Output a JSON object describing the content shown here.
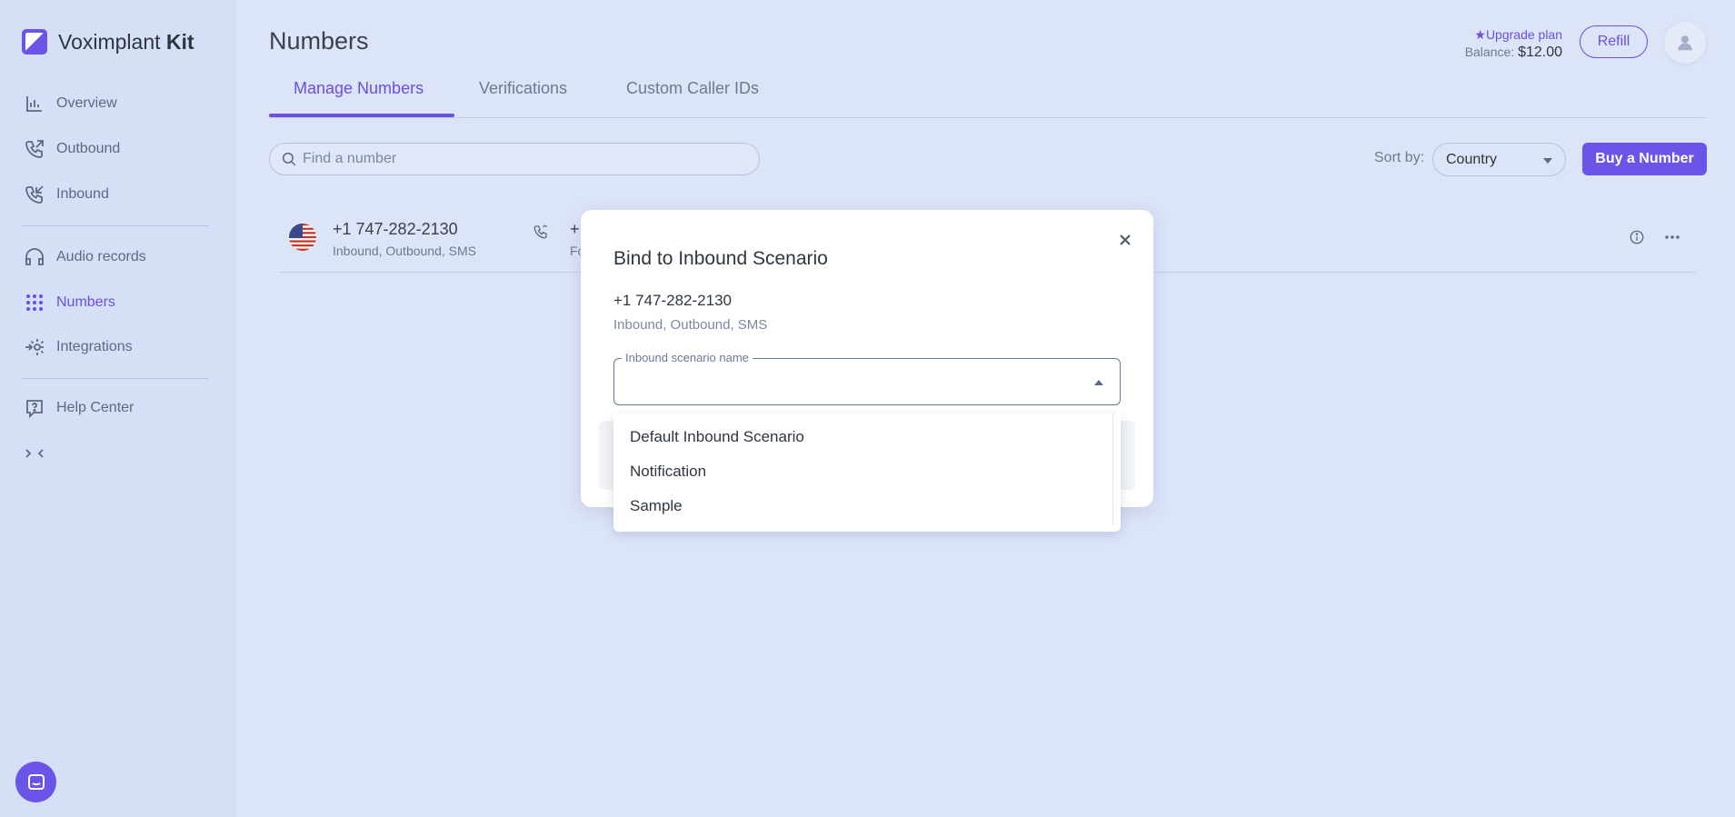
{
  "brand": {
    "name_light": "Voximplant",
    "name_bold": "Kit"
  },
  "sidebar": {
    "items": [
      {
        "label": "Overview",
        "icon": "overview-icon"
      },
      {
        "label": "Outbound",
        "icon": "outbound-call-icon"
      },
      {
        "label": "Inbound",
        "icon": "inbound-call-icon"
      },
      {
        "label": "Audio records",
        "icon": "headphones-icon"
      },
      {
        "label": "Numbers",
        "icon": "dialpad-icon",
        "active": true
      },
      {
        "label": "Integrations",
        "icon": "integrations-gear-icon"
      },
      {
        "label": "Help Center",
        "icon": "help-icon"
      }
    ],
    "collapse_icon": "collapse-arrows-icon"
  },
  "header": {
    "title": "Numbers",
    "upgrade_label": "Upgrade plan",
    "balance_label": "Balance:",
    "balance_value": "$12.00",
    "refill_label": "Refill"
  },
  "tabs": [
    "Manage Numbers",
    "Verifications",
    "Custom Caller IDs"
  ],
  "toolbar": {
    "search_placeholder": "Find a number",
    "sort_label": "Sort by:",
    "sort_value": "Country",
    "buy_label": "Buy a Number"
  },
  "numbers": [
    {
      "number": "+1 747-282-2130",
      "capabilities": "Inbound, Outbound, SMS",
      "forward_main": "+",
      "forward_sub": "Fo"
    }
  ],
  "modal": {
    "title": "Bind to Inbound Scenario",
    "number": "+1 747-282-2130",
    "capabilities": "Inbound, Outbound, SMS",
    "field_label": "Inbound scenario name",
    "options": [
      "Default Inbound Scenario",
      "Notification",
      "Sample"
    ]
  },
  "colors": {
    "accent": "#6b4fe0",
    "background": "#dce4f8",
    "sidebar": "#d5dff6"
  }
}
